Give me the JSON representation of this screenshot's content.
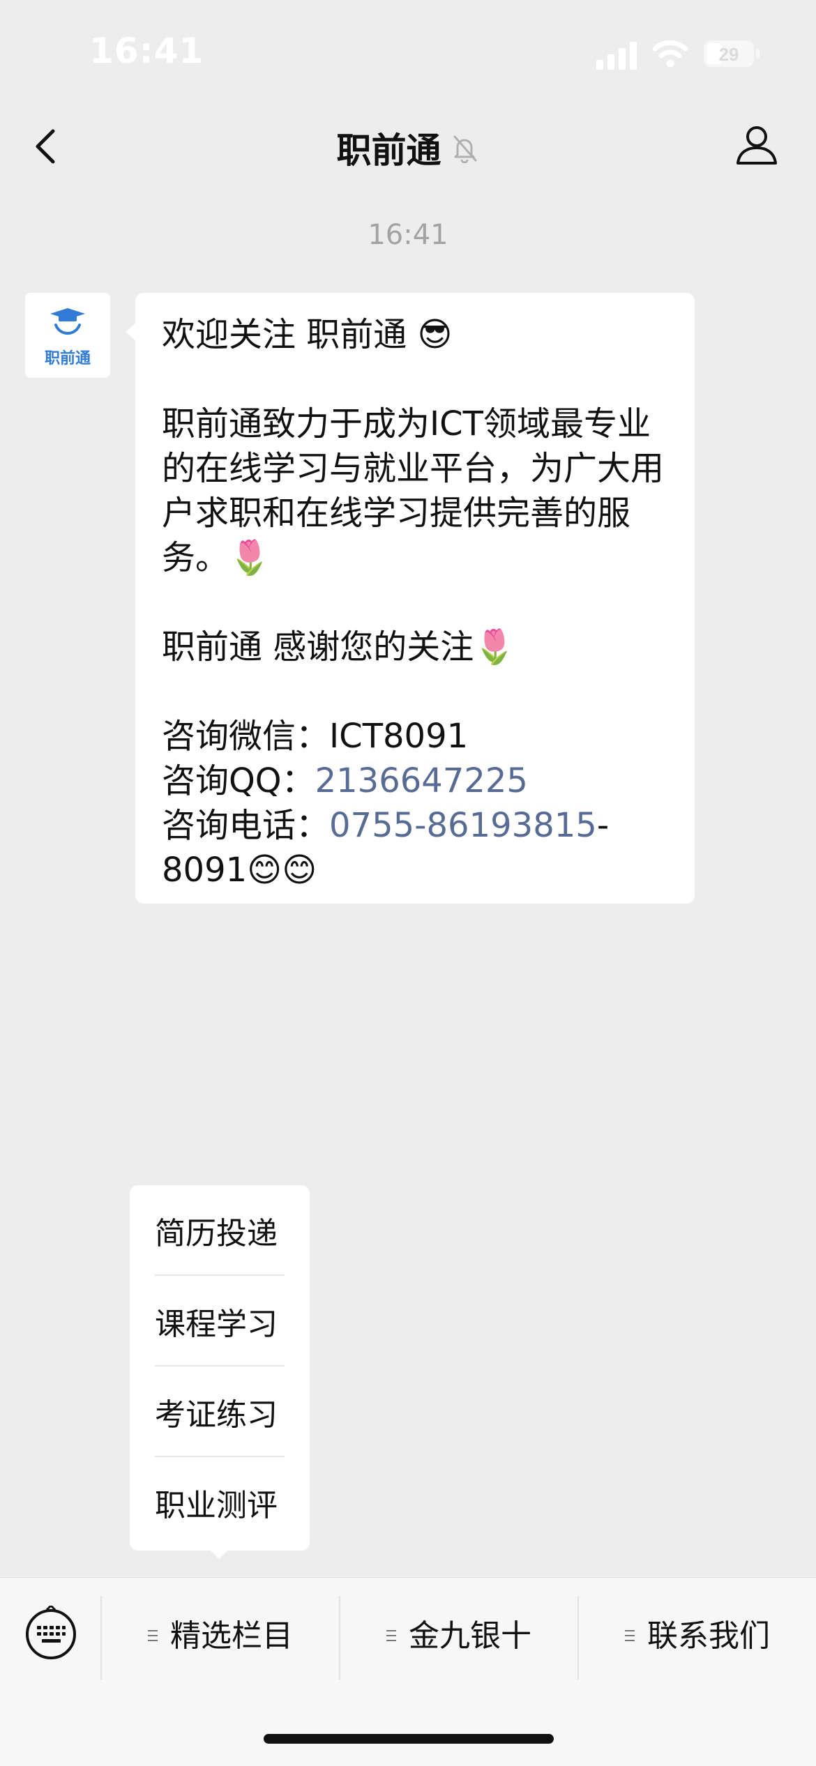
{
  "status_bar": {
    "time": "16:41",
    "battery": "29"
  },
  "nav": {
    "title": "职前通"
  },
  "chat": {
    "timestamp": "16:41",
    "account_logo_text": "职前通",
    "message": {
      "line1": "欢迎关注 职前通 😎",
      "line2": "职前通致力于成为ICT领域最专业的在线学习与就业平台，为广大用户求职和在线学习提供完善的服务。🌷",
      "line3": "职前通  感谢您的关注🌷",
      "wechat_label": "咨询微信：",
      "wechat_value": "ICT8091",
      "qq_label": "咨询QQ：",
      "qq_value": "2136647225",
      "phone_label": "咨询电话：",
      "phone_value": "0755-86193815",
      "phone_suffix": "-8091😊😊"
    }
  },
  "popup_menu": {
    "items": [
      "简历投递",
      "课程学习",
      "考证练习",
      "职业测评"
    ]
  },
  "bottom_menu": {
    "tabs": [
      "精选栏目",
      "金九银十",
      "联系我们"
    ]
  },
  "colors": {
    "background": "#ededed",
    "link": "#576b95",
    "logo_blue": "#2f7bd6"
  },
  "icons": {
    "back": "chevron-left-icon",
    "mute": "bell-slash-icon",
    "profile": "person-icon",
    "keyboard": "keyboard-icon",
    "menu_glyph": "menu-lines-icon"
  }
}
